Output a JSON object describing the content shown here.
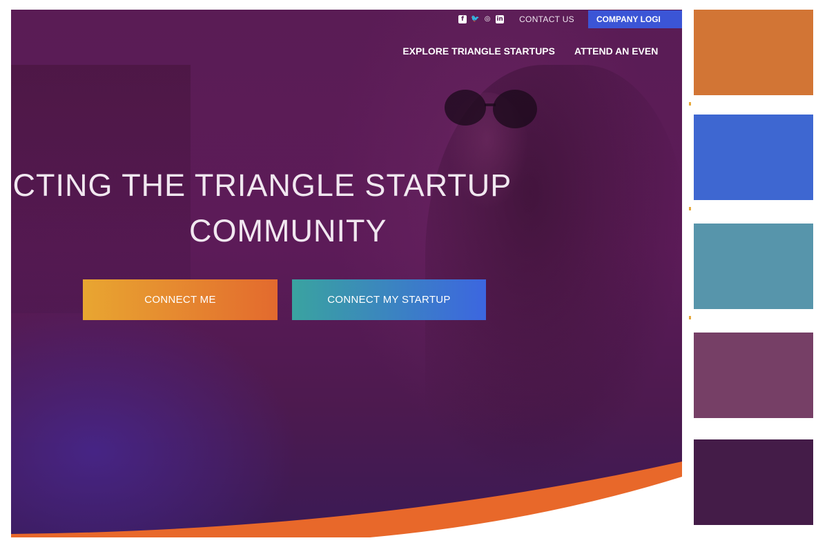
{
  "social": {
    "icons": [
      "facebook-icon",
      "twitter-icon",
      "instagram-icon",
      "linkedin-icon"
    ]
  },
  "topbar": {
    "contact": "CONTACT US",
    "login": "COMPANY LOGI"
  },
  "nav": {
    "items": [
      "EXPLORE TRIANGLE STARTUPS",
      "ATTEND AN EVEN"
    ]
  },
  "hero": {
    "headline_line1": "NECTING THE TRIANGLE STARTUP",
    "headline_line2": "COMMUNITY"
  },
  "buttons": {
    "connect_me": "CONNECT ME",
    "connect_startup": "CONNECT MY STARTUP"
  },
  "palette": {
    "swatches": [
      "#d27535",
      "#3e67d1",
      "#5795ab",
      "#763f66",
      "#441c48"
    ]
  }
}
